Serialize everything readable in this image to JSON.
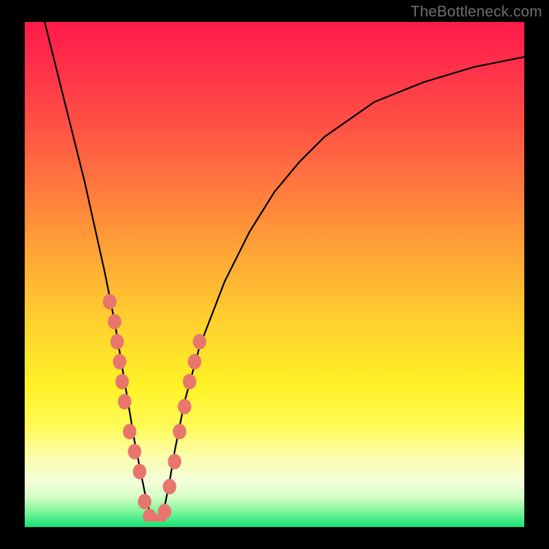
{
  "watermark": "TheBottleneck.com",
  "chart_data": {
    "type": "line",
    "title": "",
    "xlabel": "",
    "ylabel": "",
    "xlim": [
      0,
      100
    ],
    "ylim": [
      0,
      100
    ],
    "series": [
      {
        "name": "bottleneck-curve",
        "x": [
          4,
          6,
          8,
          10,
          12,
          14,
          16,
          18,
          19,
          20,
          21,
          22,
          23,
          24,
          25,
          26,
          27,
          28,
          29,
          30,
          32,
          35,
          40,
          45,
          50,
          55,
          60,
          70,
          80,
          90,
          100
        ],
        "values": [
          100,
          92,
          84,
          76,
          68,
          59,
          50,
          40,
          34,
          28,
          22,
          16,
          11,
          6,
          2,
          0,
          0,
          3,
          8,
          14,
          24,
          35,
          48,
          58,
          66,
          72,
          77,
          84,
          88,
          91,
          93
        ]
      }
    ],
    "markers": [
      {
        "name": "cluster-left",
        "points": [
          [
            17,
            44
          ],
          [
            18,
            40
          ],
          [
            18.5,
            36
          ],
          [
            19,
            32
          ],
          [
            19.5,
            28
          ],
          [
            20,
            24
          ],
          [
            21,
            18
          ],
          [
            22,
            14
          ],
          [
            23,
            10
          ]
        ]
      },
      {
        "name": "cluster-bottom",
        "points": [
          [
            24,
            4
          ],
          [
            25,
            1
          ],
          [
            26,
            0
          ],
          [
            27,
            0
          ],
          [
            28,
            2
          ]
        ]
      },
      {
        "name": "cluster-right",
        "points": [
          [
            29,
            7
          ],
          [
            30,
            12
          ],
          [
            31,
            18
          ],
          [
            32,
            23
          ],
          [
            33,
            28
          ],
          [
            34,
            32
          ],
          [
            35,
            36
          ]
        ]
      }
    ],
    "background": {
      "type": "vertical-gradient",
      "stops": [
        {
          "pos": 0.0,
          "color": "#ff1a4b"
        },
        {
          "pos": 0.5,
          "color": "#ffd22e"
        },
        {
          "pos": 0.8,
          "color": "#fffb56"
        },
        {
          "pos": 1.0,
          "color": "#13e276"
        }
      ]
    }
  }
}
